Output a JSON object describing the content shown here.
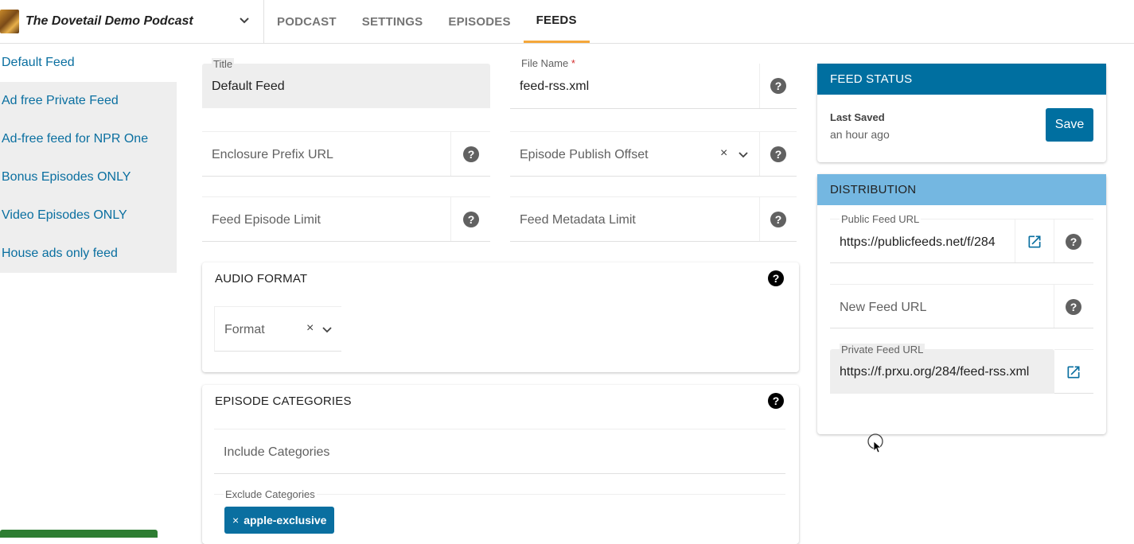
{
  "app": {
    "podcast_name": "The Dovetail Demo Podcast",
    "tabs": [
      {
        "label": "PODCAST"
      },
      {
        "label": "SETTINGS"
      },
      {
        "label": "EPISODES"
      },
      {
        "label": "FEEDS",
        "active": true
      }
    ]
  },
  "sidebar": {
    "items": [
      {
        "label": "Default Feed",
        "active": true
      },
      {
        "label": "Ad free Private Feed"
      },
      {
        "label": "Ad-free feed for NPR One"
      },
      {
        "label": "Bonus Episodes ONLY"
      },
      {
        "label": "Video Episodes ONLY"
      },
      {
        "label": "House ads only feed"
      }
    ]
  },
  "form": {
    "title": {
      "label": "Title",
      "value": "Default Feed"
    },
    "file_name": {
      "label": "File Name",
      "required_mark": "*",
      "value": "feed-rss.xml"
    },
    "enclosure_prefix": {
      "placeholder": "Enclosure Prefix URL"
    },
    "episode_publish_offset": {
      "placeholder": "Episode Publish Offset"
    },
    "feed_episode_limit": {
      "placeholder": "Feed Episode Limit"
    },
    "feed_metadata_limit": {
      "placeholder": "Feed Metadata Limit"
    },
    "help_glyph": "?",
    "clear_glyph": "×"
  },
  "audio_format": {
    "title": "AUDIO FORMAT",
    "format": {
      "placeholder": "Format"
    }
  },
  "episode_categories": {
    "title": "EPISODE CATEGORIES",
    "include": {
      "placeholder": "Include Categories"
    },
    "exclude": {
      "label": "Exclude Categories",
      "chips": [
        "apple-exclusive"
      ]
    }
  },
  "feed_status": {
    "title": "FEED STATUS",
    "last_saved_label": "Last Saved",
    "last_saved_value": "an hour ago",
    "save_label": "Save"
  },
  "distribution": {
    "title": "DISTRIBUTION",
    "public_feed": {
      "label": "Public Feed URL",
      "value": "https://publicfeeds.net/f/284"
    },
    "new_feed": {
      "placeholder": "New Feed URL"
    },
    "private_feed": {
      "label": "Private Feed URL",
      "value": "https://f.prxu.org/284/feed-rss.xml"
    }
  },
  "colors": {
    "accent": "#006fa0",
    "accent_light": "#74b7e1",
    "active_tab_underline": "#f4a73b",
    "link": "#0a6fa0"
  }
}
